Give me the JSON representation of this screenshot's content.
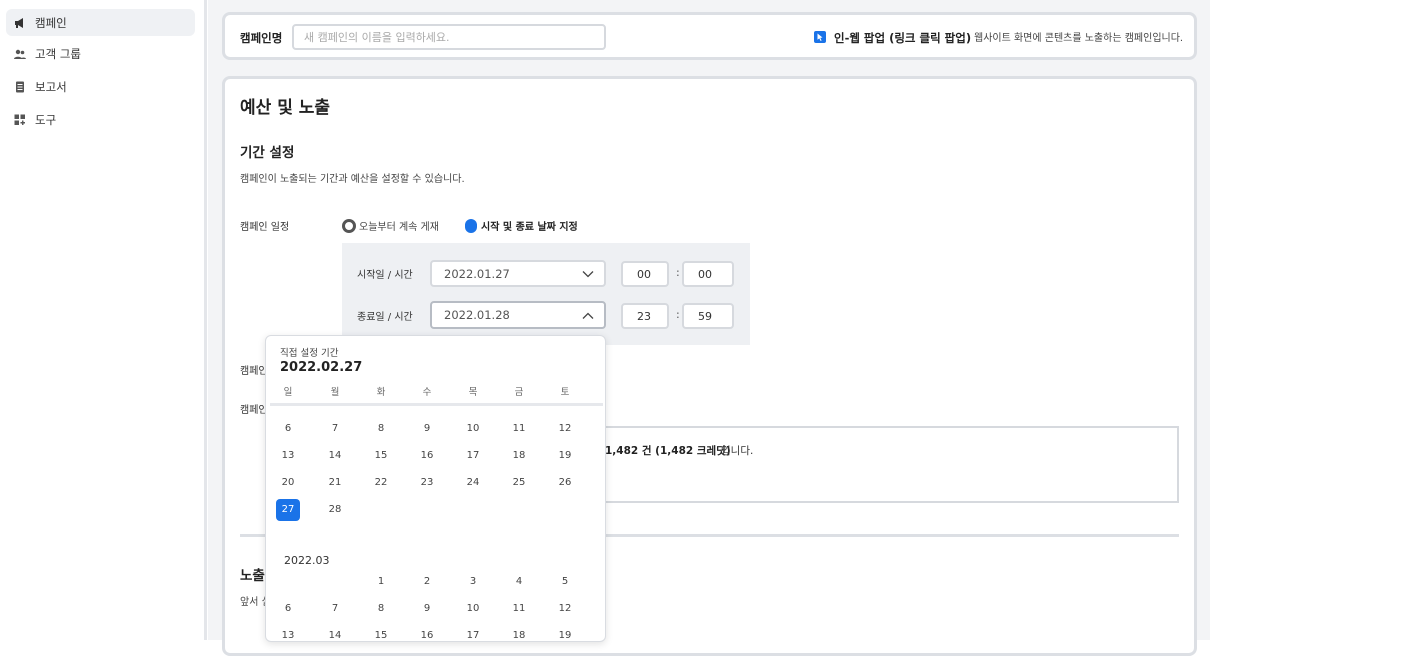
{
  "sidebar": {
    "items": [
      {
        "label": "캠페인",
        "icon": "megaphone-icon",
        "active": true
      },
      {
        "label": "고객 그룹",
        "icon": "users-icon",
        "active": false
      },
      {
        "label": "보고서",
        "icon": "document-icon",
        "active": false
      },
      {
        "label": "도구",
        "icon": "apps-icon",
        "active": false
      }
    ]
  },
  "campaign_name": {
    "label": "캠페인명",
    "placeholder": "새 캠페인의 이름을 입력하세요.",
    "type_label": "인-웹 팝업 (링크 클릭 팝업)",
    "type_desc": "웹사이트 화면에 콘텐츠를 노출하는 캠페인입니다."
  },
  "budget": {
    "title": "예산 및 노출",
    "period_title": "기간 설정",
    "period_desc": "캠페인이 노출되는 기간과 예산을 설정할 수 있습니다.",
    "schedule_label": "캠페인 일정",
    "option_continuous": "오늘부터 계속 게재",
    "option_range": "시작 및 종료 날짜 지정",
    "start_label": "시작일 / 시간",
    "start_date": "2022.01.27",
    "start_hour": "00",
    "start_min": "00",
    "end_label": "종료일 / 시간",
    "end_date": "2022.01.28",
    "end_hour": "23",
    "end_min": "59",
    "time_sep": ":",
    "row_label_1": "캠페인",
    "row_label_2": "캠페인",
    "summary_bold": "1,482 건 (1,482 크레딧)",
    "summary_suffix": "입니다.",
    "exposure_title_partial": "노출",
    "exposure_desc_partial": "앞서 실"
  },
  "calendar": {
    "caption": "직접 설정 기간",
    "selected_date": "2022.02.27",
    "weekdays": [
      "일",
      "월",
      "화",
      "수",
      "목",
      "금",
      "토"
    ],
    "feb_weeks": [
      [
        "6",
        "7",
        "8",
        "9",
        "10",
        "11",
        "12"
      ],
      [
        "13",
        "14",
        "15",
        "16",
        "17",
        "18",
        "19"
      ],
      [
        "20",
        "21",
        "22",
        "23",
        "24",
        "25",
        "26"
      ],
      [
        "27",
        "28",
        "",
        "",
        "",
        "",
        ""
      ]
    ],
    "selected_day": "27",
    "next_month_label": "2022.03",
    "mar_weeks": [
      [
        "",
        "",
        "1",
        "2",
        "3",
        "4",
        "5"
      ],
      [
        "6",
        "7",
        "8",
        "9",
        "10",
        "11",
        "12"
      ],
      [
        "13",
        "14",
        "15",
        "16",
        "17",
        "18",
        "19"
      ]
    ]
  },
  "colors": {
    "accent": "#1a73e8",
    "border": "#dcdfe4"
  }
}
